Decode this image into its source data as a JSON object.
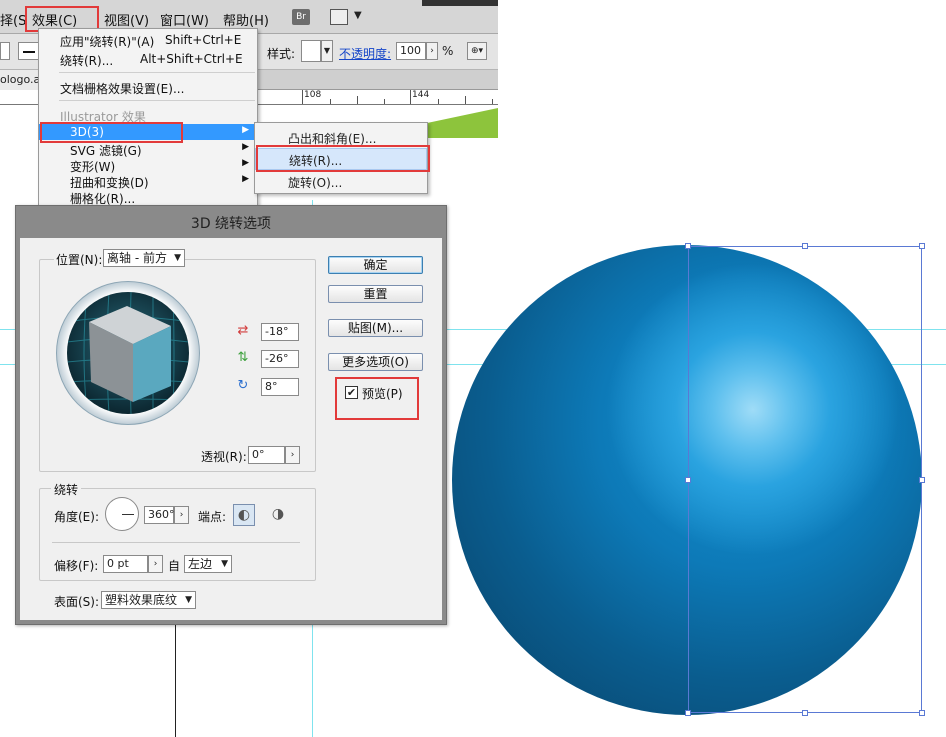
{
  "menubar": {
    "items": [
      "择(S",
      "效果(C)",
      "视图(V)",
      "窗口(W)",
      "帮助(H)"
    ],
    "br_label": "Br"
  },
  "controlbar": {
    "style_label": "样式:",
    "opacity_label": "不透明度:",
    "opacity_value": "100",
    "percent": "%"
  },
  "document": {
    "tab_label": "ologo.a"
  },
  "ruler": {
    "labels": [
      "108",
      "144"
    ]
  },
  "effect_menu": {
    "items": [
      {
        "label": "应用\"绕转(R)\"(A)",
        "shortcut": "Shift+Ctrl+E"
      },
      {
        "label": "绕转(R)...",
        "shortcut": "Alt+Shift+Ctrl+E"
      },
      {
        "label": "文档栅格效果设置(E)..."
      },
      {
        "label": "Illustrator 效果"
      },
      {
        "label": "3D(3)"
      },
      {
        "label": "SVG 滤镜(G)"
      },
      {
        "label": "变形(W)"
      },
      {
        "label": "扭曲和变换(D)"
      },
      {
        "label": "栅格化(R)..."
      }
    ]
  },
  "submenu_3d": {
    "items": [
      "凸出和斜角(E)...",
      "绕转(R)...",
      "旋转(O)..."
    ]
  },
  "dialog": {
    "title": "3D 绕转选项",
    "position_label": "位置(N):",
    "position_value": "离轴 - 前方",
    "x_angle": "-18°",
    "y_angle": "-26°",
    "z_angle": "8°",
    "perspective_label": "透视(R):",
    "perspective_value": "0°",
    "revolve_group": "绕转",
    "angle_label": "角度(E):",
    "angle_value": "360°",
    "cap_label": "端点:",
    "offset_label": "偏移(F):",
    "offset_value": "0 pt",
    "from_label": "自",
    "from_value": "左边",
    "surface_label": "表面(S):",
    "surface_value": "塑料效果底纹",
    "buttons": {
      "ok": "确定",
      "reset": "重置",
      "map": "贴图(M)...",
      "more": "更多选项(O)"
    },
    "preview_label": "预览(P)",
    "preview_checked": true
  },
  "colors": {
    "highlight_box": "#e23a3a",
    "menu_highlight": "#3399ff",
    "sphere_dark": "#083f63",
    "sphere_light": "#9fdcf7",
    "guide": "#7fe3ee",
    "green_stroke": "#8dc43c"
  }
}
